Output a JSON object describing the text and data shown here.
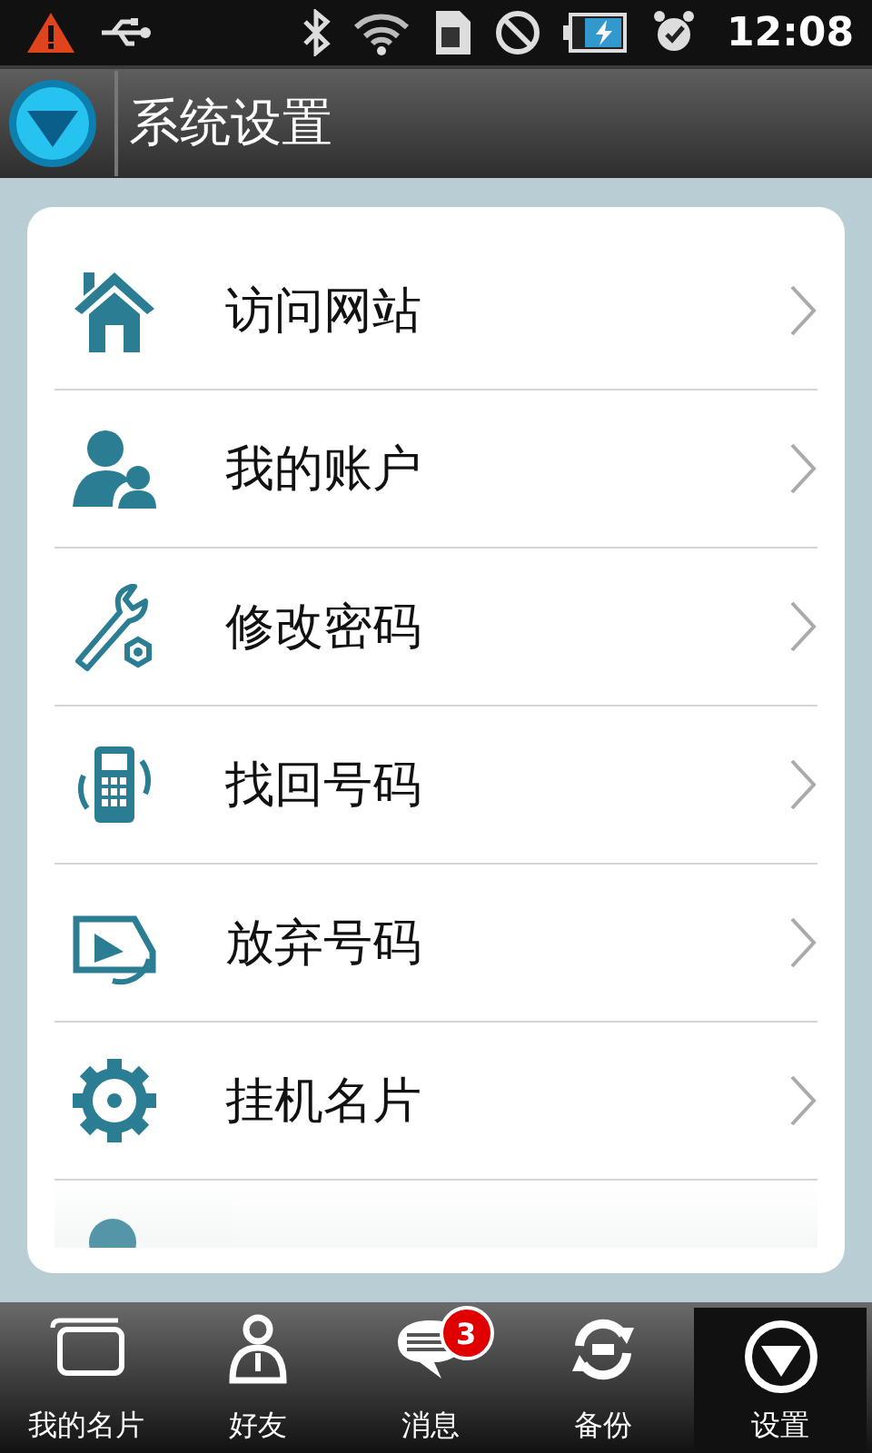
{
  "status_bar": {
    "time": "12:08"
  },
  "header": {
    "title": "系统设置"
  },
  "menu": [
    {
      "label": "访问网站"
    },
    {
      "label": "我的账户"
    },
    {
      "label": "修改密码"
    },
    {
      "label": "找回号码"
    },
    {
      "label": "放弃号码"
    },
    {
      "label": "挂机名片"
    }
  ],
  "tabs": [
    {
      "label": "我的名片",
      "selected": false
    },
    {
      "label": "好友",
      "selected": false
    },
    {
      "label": "消息",
      "selected": false,
      "badge": "3"
    },
    {
      "label": "备份",
      "selected": false
    },
    {
      "label": "设置",
      "selected": true
    }
  ]
}
